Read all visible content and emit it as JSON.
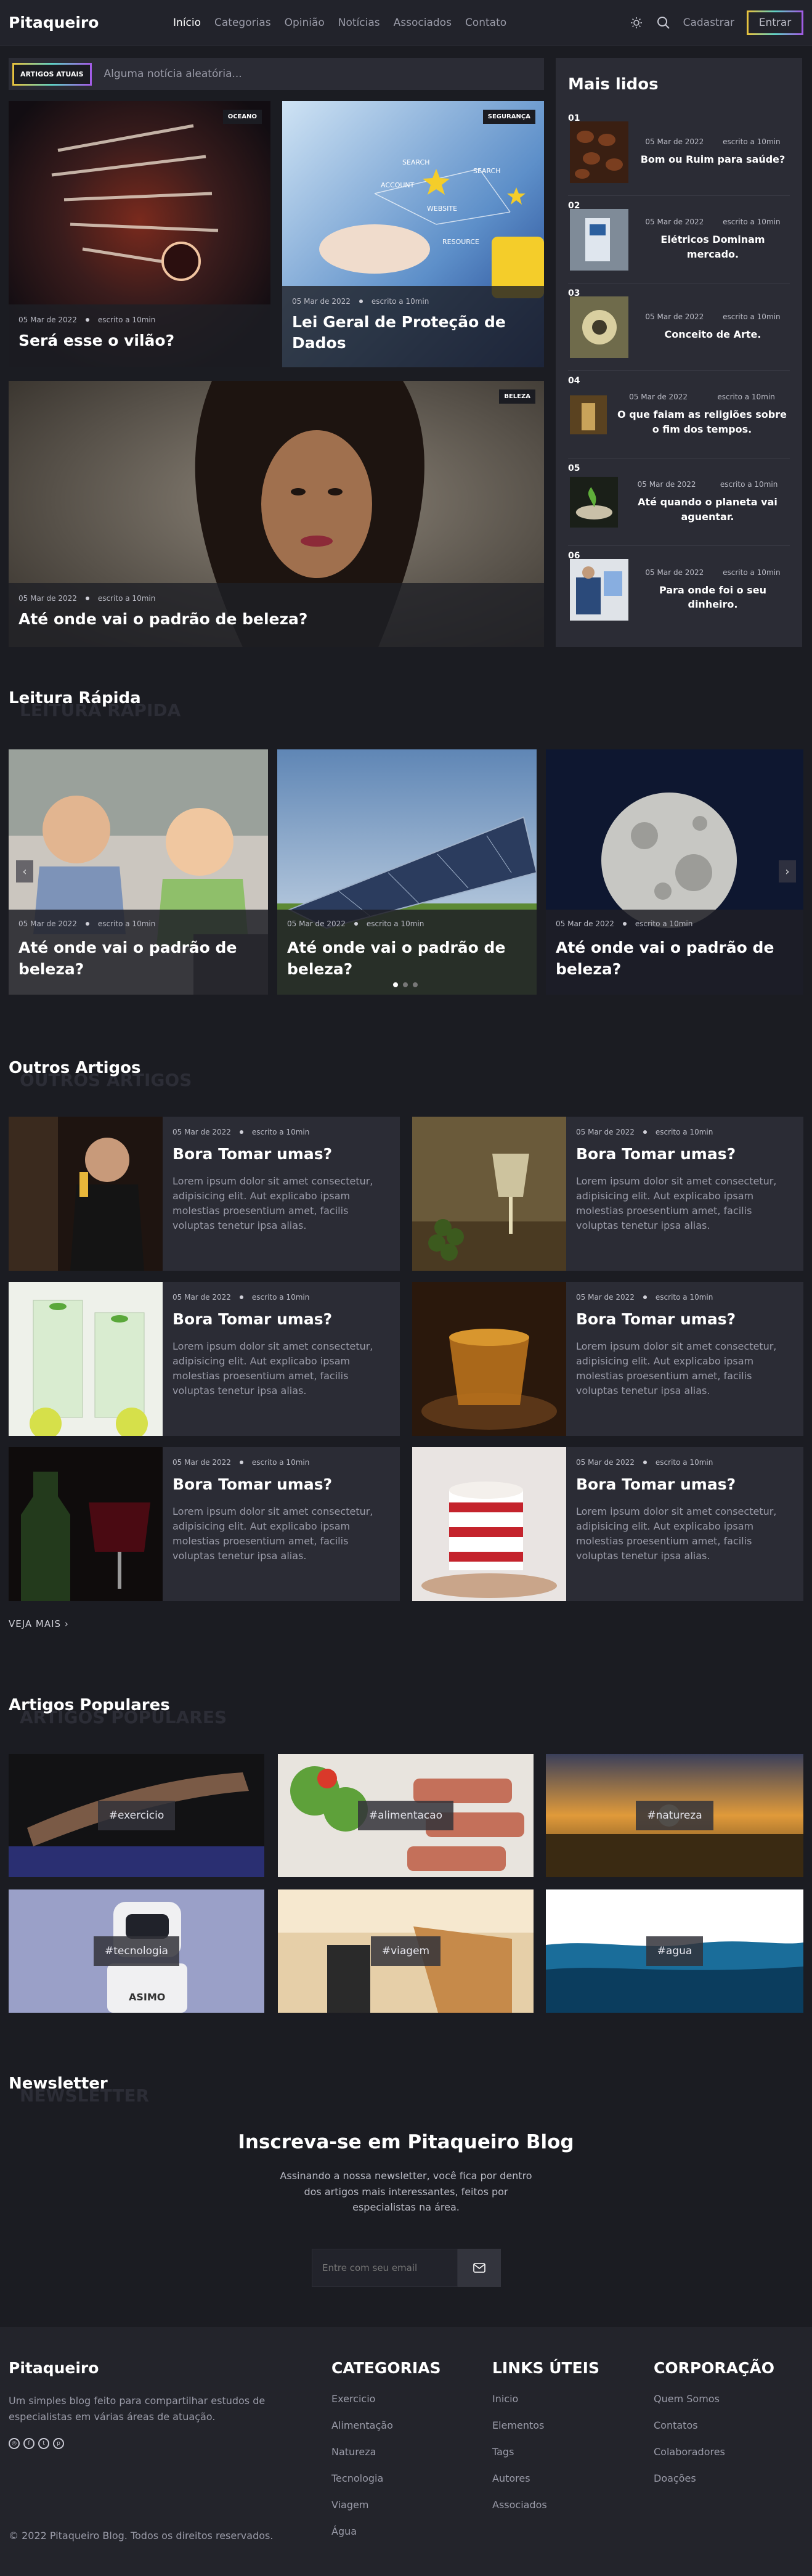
{
  "nav": {
    "logo": "Pitaqueiro",
    "items": [
      "Início",
      "Categorias",
      "Opinião",
      "Notícias",
      "Associados",
      "Contato"
    ],
    "signup": "Cadastrar",
    "login": "Entrar"
  },
  "ticker": {
    "tag": "ARTIGOS ATUAIS",
    "text": "Alguma notícia aleatória..."
  },
  "hero": [
    {
      "badge": "OCEANO",
      "date": "05 Mar de 2022",
      "read": "escrito a 10min",
      "title": "Será esse o vilão?"
    },
    {
      "badge": "SEGURANÇA",
      "date": "05 Mar de 2022",
      "read": "escrito a 10min",
      "title": "Lei Geral de Proteção de Dados"
    },
    {
      "badge": "BELEZA",
      "date": "05 Mar de 2022",
      "read": "escrito a 10min",
      "title": "Até onde vai o padrão de beleza?"
    }
  ],
  "sidebar": {
    "title": "Mais lidos",
    "items": [
      {
        "num": "01",
        "date": "05 Mar de 2022",
        "read": "escrito a 10min",
        "title": "Bom ou Ruim para saúde?"
      },
      {
        "num": "02",
        "date": "05 Mar de 2022",
        "read": "escrito a 10min",
        "title": "Elétricos Dominam mercado."
      },
      {
        "num": "03",
        "date": "05 Mar de 2022",
        "read": "escrito a 10min",
        "title": "Conceito de Arte."
      },
      {
        "num": "04",
        "date": "05 Mar de 2022",
        "read": "escrito a 10min",
        "title": "O que faiam as religiões sobre o fim dos tempos."
      },
      {
        "num": "05",
        "date": "05 Mar de 2022",
        "read": "escrito a 10min",
        "title": "Até quando o planeta vai aguentar."
      },
      {
        "num": "06",
        "date": "05 Mar de 2022",
        "read": "escrito a 10min",
        "title": "Para onde foi o seu dinheiro."
      }
    ]
  },
  "quick": {
    "title": "Leitura Rápida",
    "ghost": "LEITURA RÁPIDA",
    "items": [
      {
        "date": "05 Mar de 2022",
        "read": "escrito a 10min",
        "title": "Até onde vai o padrão de beleza?"
      },
      {
        "date": "05 Mar de 2022",
        "read": "escrito a 10min",
        "title": "Até onde vai o padrão de beleza?"
      },
      {
        "date": "05 Mar de 2022",
        "read": "escrito a 10min",
        "title": "Até onde vai o padrão de beleza?"
      }
    ]
  },
  "others": {
    "title": "Outros Artigos",
    "ghost": "OUTROS ARTIGOS",
    "items": [
      {
        "date": "05 Mar de 2022",
        "read": "escrito a 10min",
        "title": "Bora Tomar umas?",
        "text": "Lorem ipsum dolor sit amet consectetur, adipisicing elit. Aut explicabo ipsam molestias proesentium amet, facilis voluptas tenetur ipsa alias."
      },
      {
        "date": "05 Mar de 2022",
        "read": "escrito a 10min",
        "title": "Bora Tomar umas?",
        "text": "Lorem ipsum dolor sit amet consectetur, adipisicing elit. Aut explicabo ipsam molestias proesentium amet, facilis voluptas tenetur ipsa alias."
      },
      {
        "date": "05 Mar de 2022",
        "read": "escrito a 10min",
        "title": "Bora Tomar umas?",
        "text": "Lorem ipsum dolor sit amet consectetur, adipisicing elit. Aut explicabo ipsam molestias proesentium amet, facilis voluptas tenetur ipsa alias."
      },
      {
        "date": "05 Mar de 2022",
        "read": "escrito a 10min",
        "title": "Bora Tomar umas?",
        "text": "Lorem ipsum dolor sit amet consectetur, adipisicing elit. Aut explicabo ipsam molestias proesentium amet, facilis voluptas tenetur ipsa alias."
      },
      {
        "date": "05 Mar de 2022",
        "read": "escrito a 10min",
        "title": "Bora Tomar umas?",
        "text": "Lorem ipsum dolor sit amet consectetur, adipisicing elit. Aut explicabo ipsam molestias proesentium amet, facilis voluptas tenetur ipsa alias."
      },
      {
        "date": "05 Mar de 2022",
        "read": "escrito a 10min",
        "title": "Bora Tomar umas?",
        "text": "Lorem ipsum dolor sit amet consectetur, adipisicing elit. Aut explicabo ipsam molestias proesentium amet, facilis voluptas tenetur ipsa alias."
      }
    ],
    "more": "VEJA MAIS"
  },
  "popular": {
    "title": "Artigos Populares",
    "ghost": "ARTIGOS POPULARES",
    "tags": [
      "#exercicio",
      "#alimentacao",
      "#natureza",
      "#tecnologia",
      "#viagem",
      "#agua"
    ]
  },
  "newsletter": {
    "title": "Newsletter",
    "ghost": "NEWSLETTER",
    "heading": "Inscreva-se em Pitaqueiro Blog",
    "text": "Assinando a nossa newsletter, você fica por dentro dos artigos mais interessantes, feitos por especialistas na área.",
    "placeholder": "Entre com seu email"
  },
  "footer": {
    "logo": "Pitaqueiro",
    "desc": "Um simples blog feito para compartilhar estudos de especialistas em várias áreas de atuação.",
    "categorias": {
      "title": "CATEGORIAS",
      "links": [
        "Exercicio",
        "Alimentação",
        "Natureza",
        "Tecnologia",
        "Viagem",
        "Água"
      ]
    },
    "links": {
      "title": "LINKS ÚTEIS",
      "links": [
        "Inicio",
        "Elementos",
        "Tags",
        "Autores",
        "Associados"
      ]
    },
    "corp": {
      "title": "CORPORAÇÃO",
      "links": [
        "Quem Somos",
        "Contatos",
        "Colaboradores",
        "Doações"
      ]
    },
    "copy": "© 2022 Pitaqueiro Blog. Todos os direitos reservados."
  }
}
